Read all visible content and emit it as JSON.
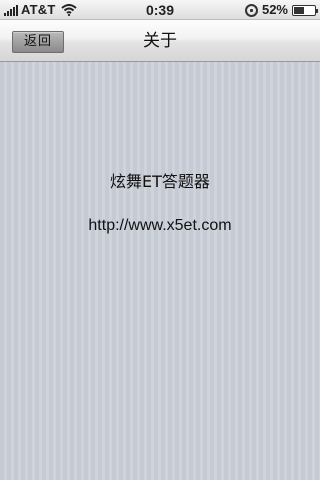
{
  "status_bar": {
    "carrier": "AT&T",
    "time": "0:39",
    "battery_percent": "52%",
    "battery_level": 0.52
  },
  "nav": {
    "back_label": "返回",
    "title": "关于"
  },
  "content": {
    "app_name": "炫舞ET答题器",
    "url": "http://www.x5et.com"
  },
  "colors": {
    "content_background": "#c9cdd6",
    "back_button": "#9d9d9d",
    "text": "#111111"
  }
}
